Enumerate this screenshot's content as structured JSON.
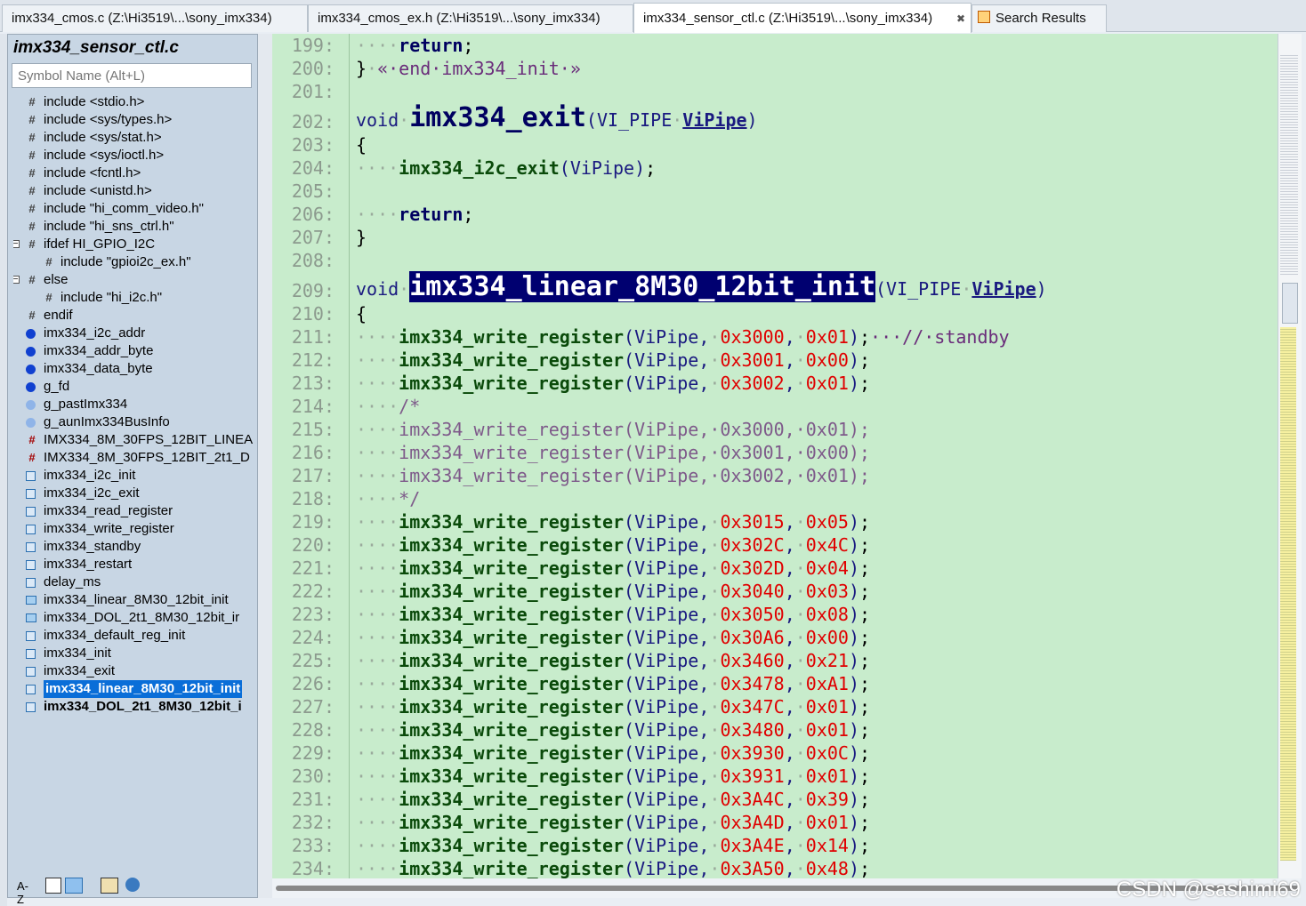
{
  "tabs": [
    {
      "label": "imx334_cmos.c (Z:\\Hi3519\\...\\sony_imx334)"
    },
    {
      "label": "imx334_cmos_ex.h (Z:\\Hi3519\\...\\sony_imx334)"
    },
    {
      "label": "imx334_sensor_ctl.c (Z:\\Hi3519\\...\\sony_imx334)",
      "close": "✖"
    },
    {
      "label": "Search Results"
    }
  ],
  "sidebar": {
    "title": "imx334_sensor_ctl.c",
    "search_placeholder": "Symbol Name (Alt+L)",
    "items": [
      {
        "label": "include <stdio.h>",
        "icon": "hash-icon"
      },
      {
        "label": "include <sys/types.h>",
        "icon": "hash-icon"
      },
      {
        "label": "include <sys/stat.h>",
        "icon": "hash-icon"
      },
      {
        "label": "include <sys/ioctl.h>",
        "icon": "hash-icon"
      },
      {
        "label": "include <fcntl.h>",
        "icon": "hash-icon"
      },
      {
        "label": "include <unistd.h>",
        "icon": "hash-icon"
      },
      {
        "label": "include \"hi_comm_video.h\"",
        "icon": "hash-icon"
      },
      {
        "label": "include \"hi_sns_ctrl.h\"",
        "icon": "hash-icon"
      },
      {
        "label": "ifdef HI_GPIO_I2C",
        "icon": "hash-icon"
      },
      {
        "label": "include \"gpioi2c_ex.h\"",
        "icon": "hash-icon"
      },
      {
        "label": "else",
        "icon": "hash-icon"
      },
      {
        "label": "include \"hi_i2c.h\"",
        "icon": "hash-icon"
      },
      {
        "label": "endif",
        "icon": "hash-icon"
      },
      {
        "label": "imx334_i2c_addr",
        "icon": "variable-icon"
      },
      {
        "label": "imx334_addr_byte",
        "icon": "variable-icon"
      },
      {
        "label": "imx334_data_byte",
        "icon": "variable-icon"
      },
      {
        "label": "g_fd",
        "icon": "variable-icon"
      },
      {
        "label": "g_pastImx334",
        "icon": "local-variable-icon"
      },
      {
        "label": "g_aunImx334BusInfo",
        "icon": "local-variable-icon"
      },
      {
        "label": "IMX334_8M_30FPS_12BIT_LINEA",
        "icon": "macro-icon"
      },
      {
        "label": "IMX334_8M_30FPS_12BIT_2t1_D",
        "icon": "macro-icon"
      },
      {
        "label": "imx334_i2c_init",
        "icon": "function-icon"
      },
      {
        "label": "imx334_i2c_exit",
        "icon": "function-icon"
      },
      {
        "label": "imx334_read_register",
        "icon": "function-icon"
      },
      {
        "label": "imx334_write_register",
        "icon": "function-icon"
      },
      {
        "label": "imx334_standby",
        "icon": "function-icon"
      },
      {
        "label": "imx334_restart",
        "icon": "function-icon"
      },
      {
        "label": "delay_ms",
        "icon": "function-icon"
      },
      {
        "label": "imx334_linear_8M30_12bit_init",
        "icon": "function-decl-icon"
      },
      {
        "label": "imx334_DOL_2t1_8M30_12bit_ir",
        "icon": "function-decl-icon"
      },
      {
        "label": "imx334_default_reg_init",
        "icon": "function-icon"
      },
      {
        "label": "imx334_init",
        "icon": "function-icon"
      },
      {
        "label": "imx334_exit",
        "icon": "function-icon"
      },
      {
        "label": "imx334_linear_8M30_12bit_init",
        "icon": "function-icon",
        "selected": true
      },
      {
        "label": "imx334_DOL_2t1_8M30_12bit_i",
        "icon": "function-icon",
        "bold": true
      }
    ],
    "toolbar": {
      "sort_label": "A-Z"
    }
  },
  "editor": {
    "lines": [
      {
        "n": "199:",
        "text": "    return;"
      },
      {
        "n": "200:",
        "text": "} « end imx334_init »"
      },
      {
        "n": "201:",
        "text": ""
      },
      {
        "n": "202:",
        "text": "void imx334_exit(VI_PIPE ViPipe)"
      },
      {
        "n": "203:",
        "text": "{"
      },
      {
        "n": "204:",
        "text": "    imx334_i2c_exit(ViPipe);"
      },
      {
        "n": "205:",
        "text": ""
      },
      {
        "n": "206:",
        "text": "    return;"
      },
      {
        "n": "207:",
        "text": "}"
      },
      {
        "n": "208:",
        "text": ""
      },
      {
        "n": "209:",
        "text": "void imx334_linear_8M30_12bit_init(VI_PIPE ViPipe)"
      },
      {
        "n": "210:",
        "text": "{"
      },
      {
        "n": "211:",
        "text": "    imx334_write_register(ViPipe, 0x3000, 0x01);   // standby"
      },
      {
        "n": "212:",
        "text": "    imx334_write_register(ViPipe, 0x3001, 0x00);"
      },
      {
        "n": "213:",
        "text": "    imx334_write_register(ViPipe, 0x3002, 0x01);"
      },
      {
        "n": "214:",
        "text": "    /*"
      },
      {
        "n": "215:",
        "text": "    imx334_write_register(ViPipe, 0x3000, 0x01);"
      },
      {
        "n": "216:",
        "text": "    imx334_write_register(ViPipe, 0x3001, 0x00);"
      },
      {
        "n": "217:",
        "text": "    imx334_write_register(ViPipe, 0x3002, 0x01);"
      },
      {
        "n": "218:",
        "text": "    */"
      },
      {
        "n": "219:",
        "text": "    imx334_write_register(ViPipe, 0x3015, 0x05);"
      },
      {
        "n": "220:",
        "text": "    imx334_write_register(ViPipe, 0x302C, 0x4C);"
      },
      {
        "n": "221:",
        "text": "    imx334_write_register(ViPipe, 0x302D, 0x04);"
      },
      {
        "n": "222:",
        "text": "    imx334_write_register(ViPipe, 0x3040, 0x03);"
      },
      {
        "n": "223:",
        "text": "    imx334_write_register(ViPipe, 0x3050, 0x08);"
      },
      {
        "n": "224:",
        "text": "    imx334_write_register(ViPipe, 0x30A6, 0x00);"
      },
      {
        "n": "225:",
        "text": "    imx334_write_register(ViPipe, 0x3460, 0x21);"
      },
      {
        "n": "226:",
        "text": "    imx334_write_register(ViPipe, 0x3478, 0xA1);"
      },
      {
        "n": "227:",
        "text": "    imx334_write_register(ViPipe, 0x347C, 0x01);"
      },
      {
        "n": "228:",
        "text": "    imx334_write_register(ViPipe, 0x3480, 0x01);"
      },
      {
        "n": "229:",
        "text": "    imx334_write_register(ViPipe, 0x3930, 0x0C);"
      },
      {
        "n": "230:",
        "text": "    imx334_write_register(ViPipe, 0x3931, 0x01);"
      },
      {
        "n": "231:",
        "text": "    imx334_write_register(ViPipe, 0x3A4C, 0x39);"
      },
      {
        "n": "232:",
        "text": "    imx334_write_register(ViPipe, 0x3A4D, 0x01);"
      },
      {
        "n": "233:",
        "text": "    imx334_write_register(ViPipe, 0x3A4E, 0x14);"
      },
      {
        "n": "234:",
        "text": "    imx334_write_register(ViPipe, 0x3A50, 0x48);"
      }
    ]
  },
  "watermark": "CSDN @sashimi69",
  "colors": {
    "editor_bg": "#c8eccc",
    "highlight": "#000070",
    "number": "#e00000",
    "selection": "#0a6ed8"
  }
}
